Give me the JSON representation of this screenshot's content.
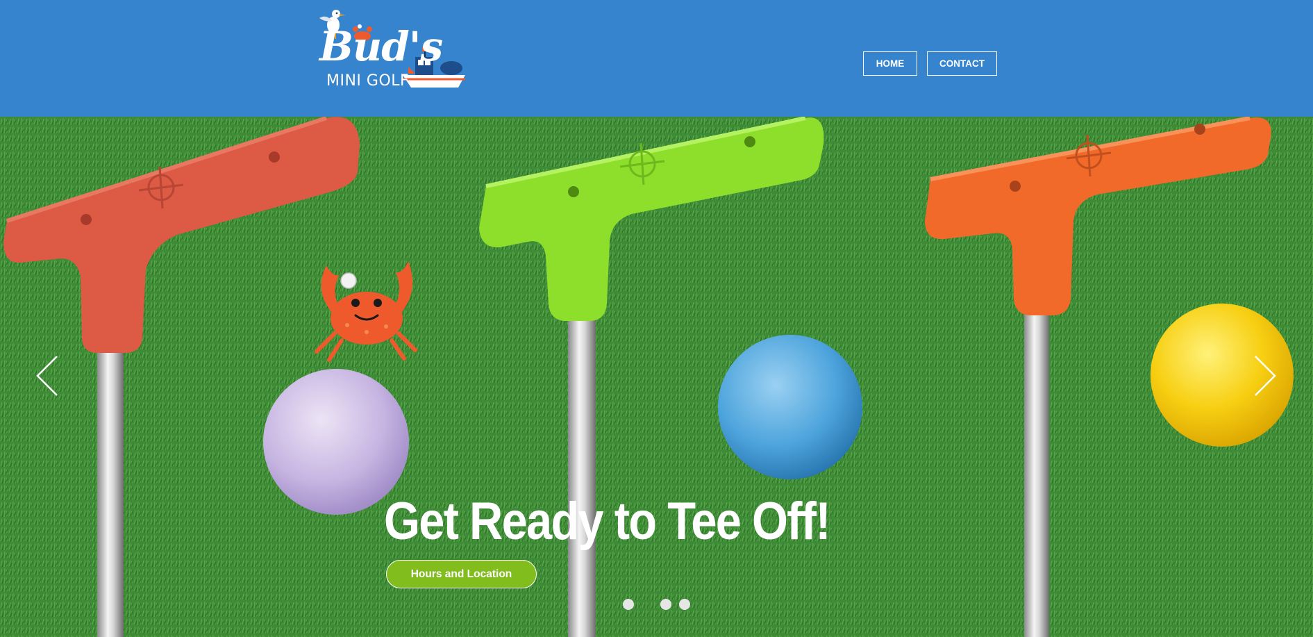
{
  "logo": {
    "title": "Bud's",
    "subtitle": "MINI GOLF"
  },
  "nav": {
    "items": [
      {
        "label": "HOME"
      },
      {
        "label": "CONTACT"
      }
    ]
  },
  "hero": {
    "headline": "Get Ready  to Tee Off!",
    "cta_label": "Hours and Location",
    "slide_count": 4,
    "active_slide": 2
  },
  "colors": {
    "header_bg": "#3584cd",
    "cta_bg": "#82bd1e",
    "text": "#ffffff"
  },
  "icons": {
    "prev": "chevron-left-icon",
    "next": "chevron-right-icon"
  }
}
